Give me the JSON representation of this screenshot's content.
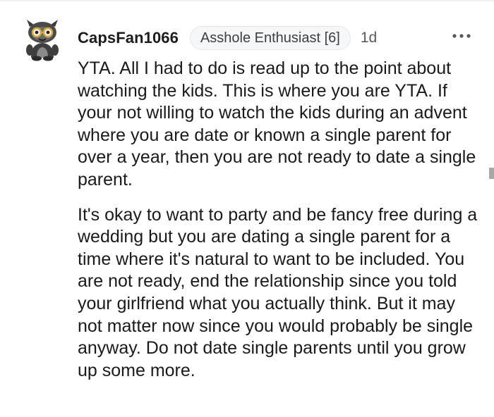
{
  "comment": {
    "username": "CapsFan1066",
    "flair": "Asshole Enthusiast [6]",
    "age": "1d",
    "more_icon": "more-horizontal-icon",
    "avatar_icon": "snoo-avatar-icon",
    "paragraphs": [
      "YTA. All I had to do is read up to the point about watching the kids. This is where you are YTA. If your not willing to watch the kids during an advent where you are date or known a single parent for over a year, then you are not ready to date a single parent.",
      "It's okay to want to party and be fancy free during a wedding but you are dating a single parent for a time where it's natural to want to be included. You are not ready, end the relationship since you told your girlfriend what you actually think. But it may not matter now since you would probably be single anyway. Do not date single parents until you grow up some more."
    ]
  },
  "colors": {
    "text": "#1a1a1b",
    "meta": "#555a5e",
    "flair_border": "#e3e5e7",
    "flair_bg": "#f6f7f8"
  }
}
